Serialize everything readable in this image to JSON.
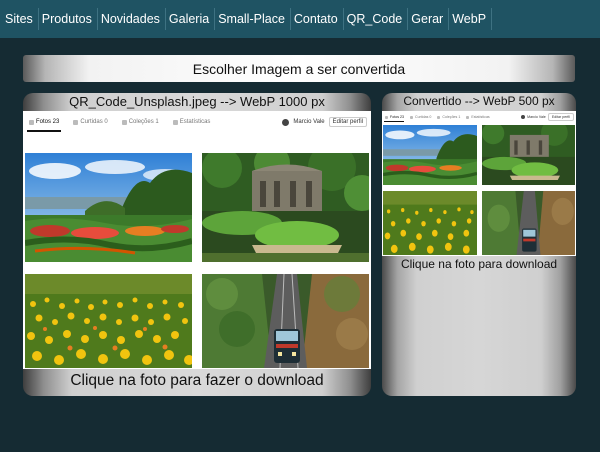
{
  "nav": {
    "items": [
      {
        "id": "sites",
        "label": "Sites"
      },
      {
        "id": "produtos",
        "label": "Produtos"
      },
      {
        "id": "novidades",
        "label": "Novidades"
      },
      {
        "id": "galeria",
        "label": "Galeria"
      },
      {
        "id": "small-place",
        "label": "Small-Place"
      },
      {
        "id": "contato",
        "label": "Contato"
      },
      {
        "id": "qr-code",
        "label": "QR_Code"
      },
      {
        "id": "gerar",
        "label": "Gerar"
      },
      {
        "id": "webp",
        "label": "WebP"
      }
    ]
  },
  "choose": {
    "label": "Escolher Imagem a ser convertida"
  },
  "source_panel": {
    "title": "QR_Code_Unsplash.jpeg --> WebP 1000 px",
    "download": "Clique na foto para fazer o download",
    "tabs": {
      "photos": "Fotos 23",
      "likes": "Curtidas 0",
      "collections": "Coleções 1",
      "stats": "Estatísticas"
    },
    "user": "Marcio Vale",
    "edit": "Editar perfil"
  },
  "result_panel": {
    "title": "Convertido --> WebP 500 px",
    "download": "Clique na foto para download",
    "tabs": {
      "photos": "Fotos 23",
      "likes": "Curtidas 0",
      "collections": "Coleções 1",
      "stats": "Estatísticas"
    },
    "user": "Marcio Vale",
    "edit": "Editar perfil"
  },
  "colors": {
    "nav_bg": "#1f5363",
    "page_bg": "#152b33"
  }
}
